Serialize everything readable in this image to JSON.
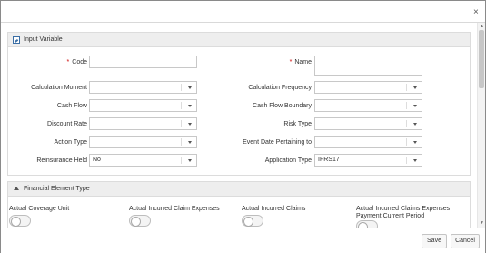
{
  "dialog": {
    "close_glyph": "×"
  },
  "input_variable": {
    "title": "Input Variable",
    "fields": {
      "code": {
        "label": "Code",
        "required_mark": "*",
        "value": ""
      },
      "name": {
        "label": "Name",
        "required_mark": "*",
        "value": ""
      },
      "calculation_moment": {
        "label": "Calculation Moment",
        "value": ""
      },
      "calculation_frequency": {
        "label": "Calculation Frequency",
        "value": ""
      },
      "cash_flow": {
        "label": "Cash Flow",
        "value": ""
      },
      "cash_flow_boundary": {
        "label": "Cash Flow Boundary",
        "value": ""
      },
      "discount_rate": {
        "label": "Discount Rate",
        "value": ""
      },
      "risk_type": {
        "label": "Risk Type",
        "value": ""
      },
      "action_type": {
        "label": "Action Type",
        "value": ""
      },
      "event_date": {
        "label": "Event Date Pertaining to",
        "value": ""
      },
      "reinsurance_held": {
        "label": "Reinsurance Held",
        "value": "No"
      },
      "application_type": {
        "label": "Application Type",
        "value": "IFRS17"
      }
    }
  },
  "financial_element_type": {
    "title": "Financial Element Type",
    "items": [
      {
        "label": "Actual Coverage Unit",
        "on": false
      },
      {
        "label": "Actual Incurred Claim Expenses",
        "on": false
      },
      {
        "label": "Actual Incurred Claims",
        "on": false
      },
      {
        "label": "Actual Incurred Claims Expenses",
        "label2": "Payment Current Period",
        "on": false
      }
    ]
  },
  "footer": {
    "save_label": "Save",
    "cancel_label": "Cancel"
  }
}
